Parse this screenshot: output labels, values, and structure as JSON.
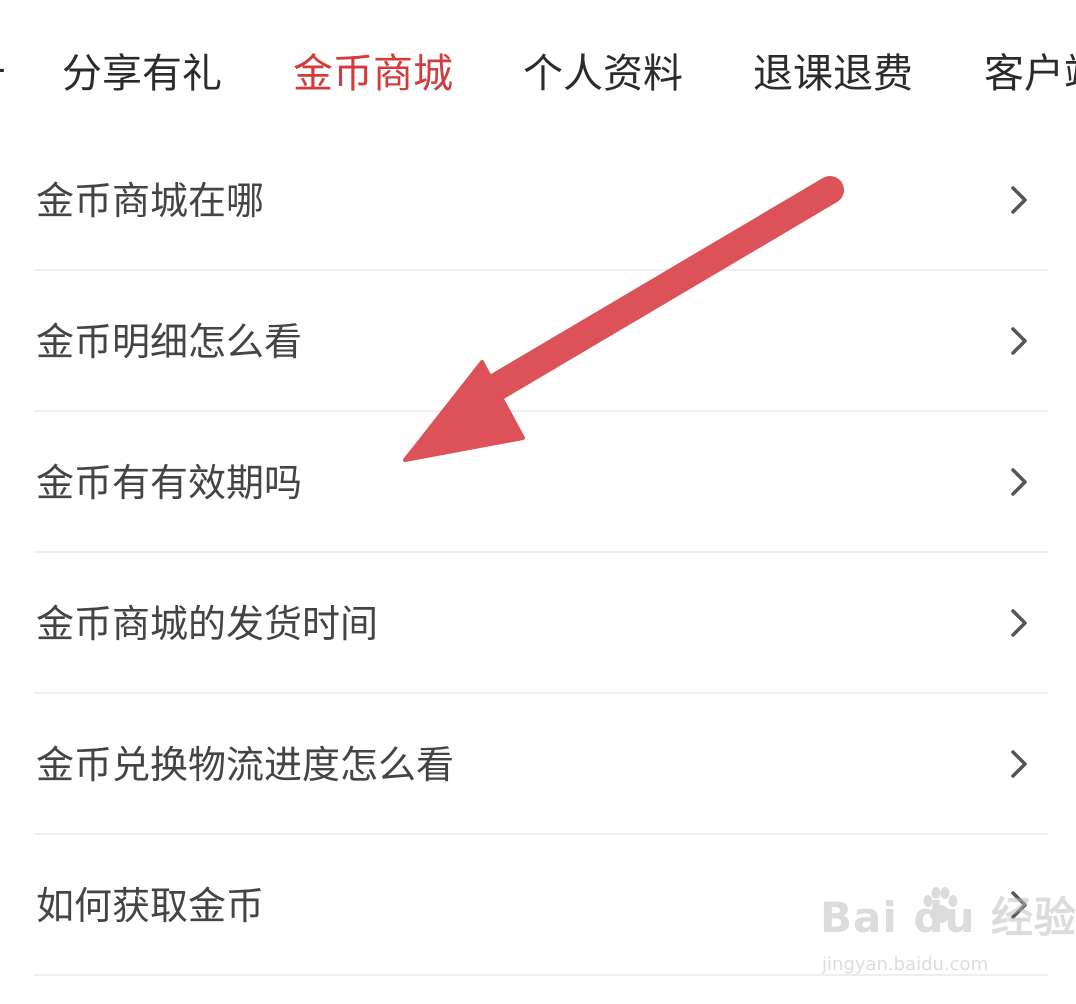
{
  "tabs": [
    {
      "label": "分享有礼",
      "active": false
    },
    {
      "label": "金币商城",
      "active": true
    },
    {
      "label": "个人资料",
      "active": false
    },
    {
      "label": "退课退费",
      "active": false
    },
    {
      "label": "客户端",
      "active": false
    }
  ],
  "faq": [
    {
      "label": "金币商城在哪"
    },
    {
      "label": "金币明细怎么看"
    },
    {
      "label": "金币有有效期吗"
    },
    {
      "label": "金币商城的发货时间"
    },
    {
      "label": "金币兑换物流进度怎么看"
    },
    {
      "label": "如何获取金币"
    }
  ],
  "watermark": {
    "brand": "Bai du 经验",
    "url": "jingyan.baidu.com"
  },
  "colors": {
    "active_tab": "#d13c3c",
    "arrow": "#dc5258",
    "text": "#444444",
    "divider": "#efefef"
  },
  "icons": {
    "row_chevron": "chevron-right-icon",
    "annotation": "arrow-annotation-icon"
  }
}
